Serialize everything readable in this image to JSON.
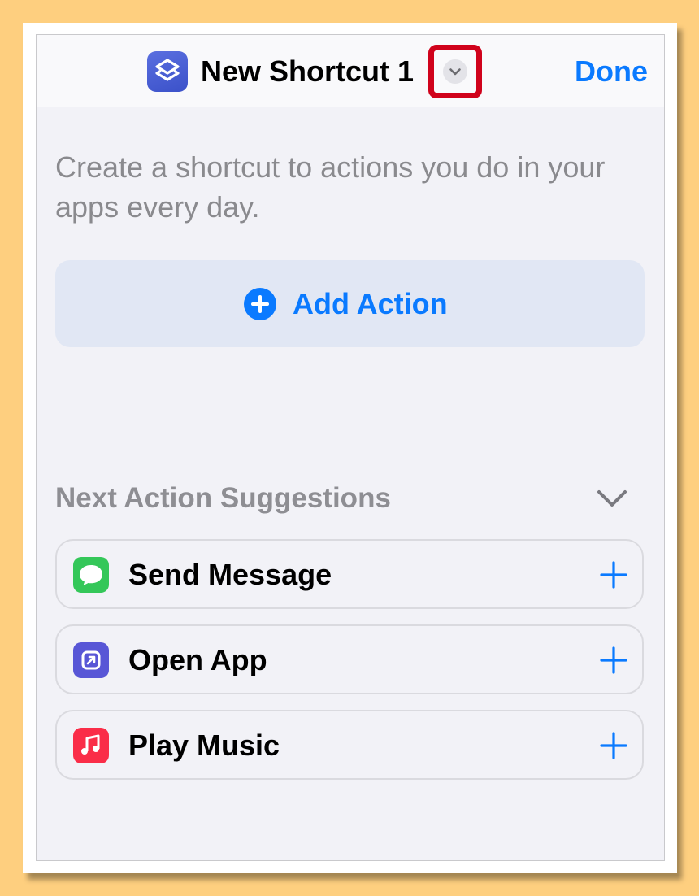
{
  "navbar": {
    "title": "New Shortcut 1",
    "done_label": "Done",
    "app_icon": "shortcuts-icon",
    "chevron_icon": "chevron-down-icon"
  },
  "intro_text": "Create a shortcut to actions you do in your apps every day.",
  "add_action": {
    "label": "Add Action",
    "icon": "plus-circle-icon"
  },
  "suggestions": {
    "header": "Next Action Suggestions",
    "collapse_icon": "chevron-down-icon",
    "items": [
      {
        "label": "Send Message",
        "icon": "messages-icon",
        "color": "#34C759"
      },
      {
        "label": "Open App",
        "icon": "open-app-icon",
        "color": "#5856D6"
      },
      {
        "label": "Play Music",
        "icon": "music-icon",
        "color": "#FA2D48"
      }
    ]
  },
  "colors": {
    "accent": "#0A7AFF",
    "highlight": "#D0021B",
    "background": "#FECF7F"
  }
}
